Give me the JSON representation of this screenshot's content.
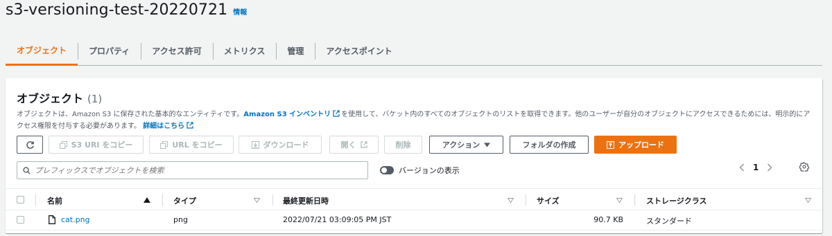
{
  "header": {
    "bucket_name": "s3-versioning-test-20220721",
    "info_label": "情報"
  },
  "tabs": [
    {
      "label": "オブジェクト",
      "active": true
    },
    {
      "label": "プロパティ"
    },
    {
      "label": "アクセス許可"
    },
    {
      "label": "メトリクス"
    },
    {
      "label": "管理"
    },
    {
      "label": "アクセスポイント"
    }
  ],
  "objects_panel": {
    "title": "オブジェクト",
    "count": "(1)",
    "desc_part1": "オブジェクトは、Amazon S3 に保存された基本的なエンティティです。",
    "inventory_link": "Amazon S3 インベントリ",
    "desc_part2": "を使用して、バケット内のすべてのオブジェクトのリストを取得できます。他のユーザーが自分のオブジェクトにアクセスできるためには、明示的にアクセス権限を付与する必要があります。",
    "details_link": "詳細はこちら"
  },
  "toolbar": {
    "copy_s3_uri": "S3 URI をコピー",
    "copy_url": "URL をコピー",
    "download": "ダウンロード",
    "open": "開く",
    "delete": "削除",
    "actions": "アクション",
    "create_folder": "フォルダの作成",
    "upload": "アップロード"
  },
  "search": {
    "placeholder": "プレフィックスでオブジェクトを検索"
  },
  "versions_toggle": {
    "label": "バージョンの表示",
    "on": false
  },
  "pagination": {
    "page": "1"
  },
  "table": {
    "columns": [
      "名前",
      "タイプ",
      "最終更新日時",
      "サイズ",
      "ストレージクラス"
    ],
    "rows": [
      {
        "name": "cat.png",
        "type": "png",
        "last_modified": "2022/07/21 03:09:05 PM JST",
        "size": "90.7 KB",
        "storage_class": "スタンダード"
      }
    ]
  },
  "colors": {
    "accent": "#ec7211",
    "link": "#0073bb"
  }
}
